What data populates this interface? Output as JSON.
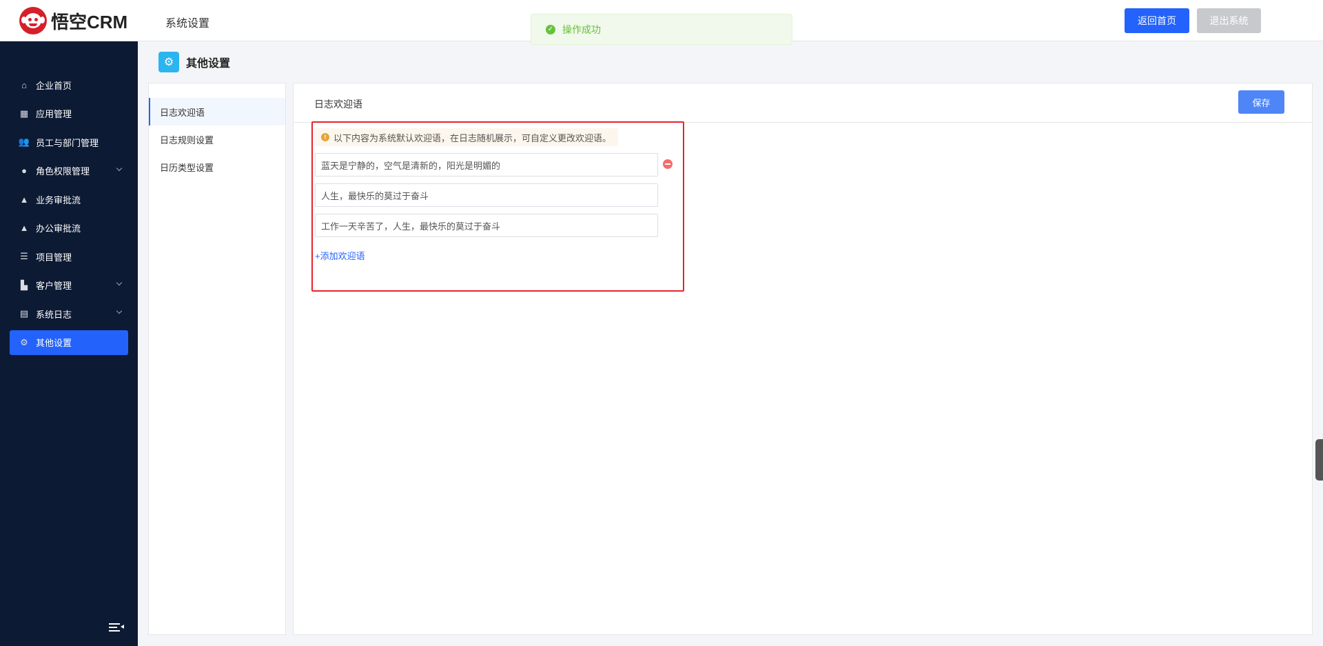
{
  "header": {
    "logo_text": "悟空CRM",
    "title": "系统设置",
    "home_button": "返回首页",
    "exit_button": "退出系统"
  },
  "toast": {
    "message": "操作成功"
  },
  "sidebar": {
    "items": [
      {
        "label": "企业首页",
        "icon": "home-icon",
        "glyph": "⌂",
        "expandable": false,
        "active": false
      },
      {
        "label": "应用管理",
        "icon": "grid-icon",
        "glyph": "▦",
        "expandable": false,
        "active": false
      },
      {
        "label": "员工与部门管理",
        "icon": "users-icon",
        "glyph": "👥",
        "expandable": false,
        "active": false
      },
      {
        "label": "角色权限管理",
        "icon": "user-icon",
        "glyph": "●",
        "expandable": true,
        "active": false
      },
      {
        "label": "业务审批流",
        "icon": "stamp-icon",
        "glyph": "▲",
        "expandable": false,
        "active": false
      },
      {
        "label": "办公审批流",
        "icon": "stamp-icon",
        "glyph": "▲",
        "expandable": false,
        "active": false
      },
      {
        "label": "项目管理",
        "icon": "list-icon",
        "glyph": "☰",
        "expandable": false,
        "active": false
      },
      {
        "label": "客户管理",
        "icon": "building-icon",
        "glyph": "▙",
        "expandable": true,
        "active": false
      },
      {
        "label": "系统日志",
        "icon": "clipboard-icon",
        "glyph": "▤",
        "expandable": true,
        "active": false
      },
      {
        "label": "其他设置",
        "icon": "gear-icon",
        "glyph": "⚙",
        "expandable": false,
        "active": true
      }
    ]
  },
  "page": {
    "title": "其他设置"
  },
  "subpanel": {
    "items": [
      {
        "label": "日志欢迎语",
        "active": true
      },
      {
        "label": "日志规则设置",
        "active": false
      },
      {
        "label": "日历类型设置",
        "active": false
      }
    ]
  },
  "content": {
    "title": "日志欢迎语",
    "save_button": "保存",
    "tip": "以下内容为系统默认欢迎语，在日志随机展示，可自定义更改欢迎语。",
    "greetings": [
      "蓝天是宁静的，空气是清新的，阳光是明媚的",
      "人生，最快乐的莫过于奋斗",
      "工作一天辛苦了，人生，最快乐的莫过于奋斗"
    ],
    "add_link": "+添加欢迎语"
  },
  "colors": {
    "accent": "#2362fb",
    "sidebar_bg": "#0d1a34",
    "success": "#67c23a",
    "warning": "#e6a23c",
    "danger": "#f56c6c",
    "highlight_border": "#e8222b"
  }
}
